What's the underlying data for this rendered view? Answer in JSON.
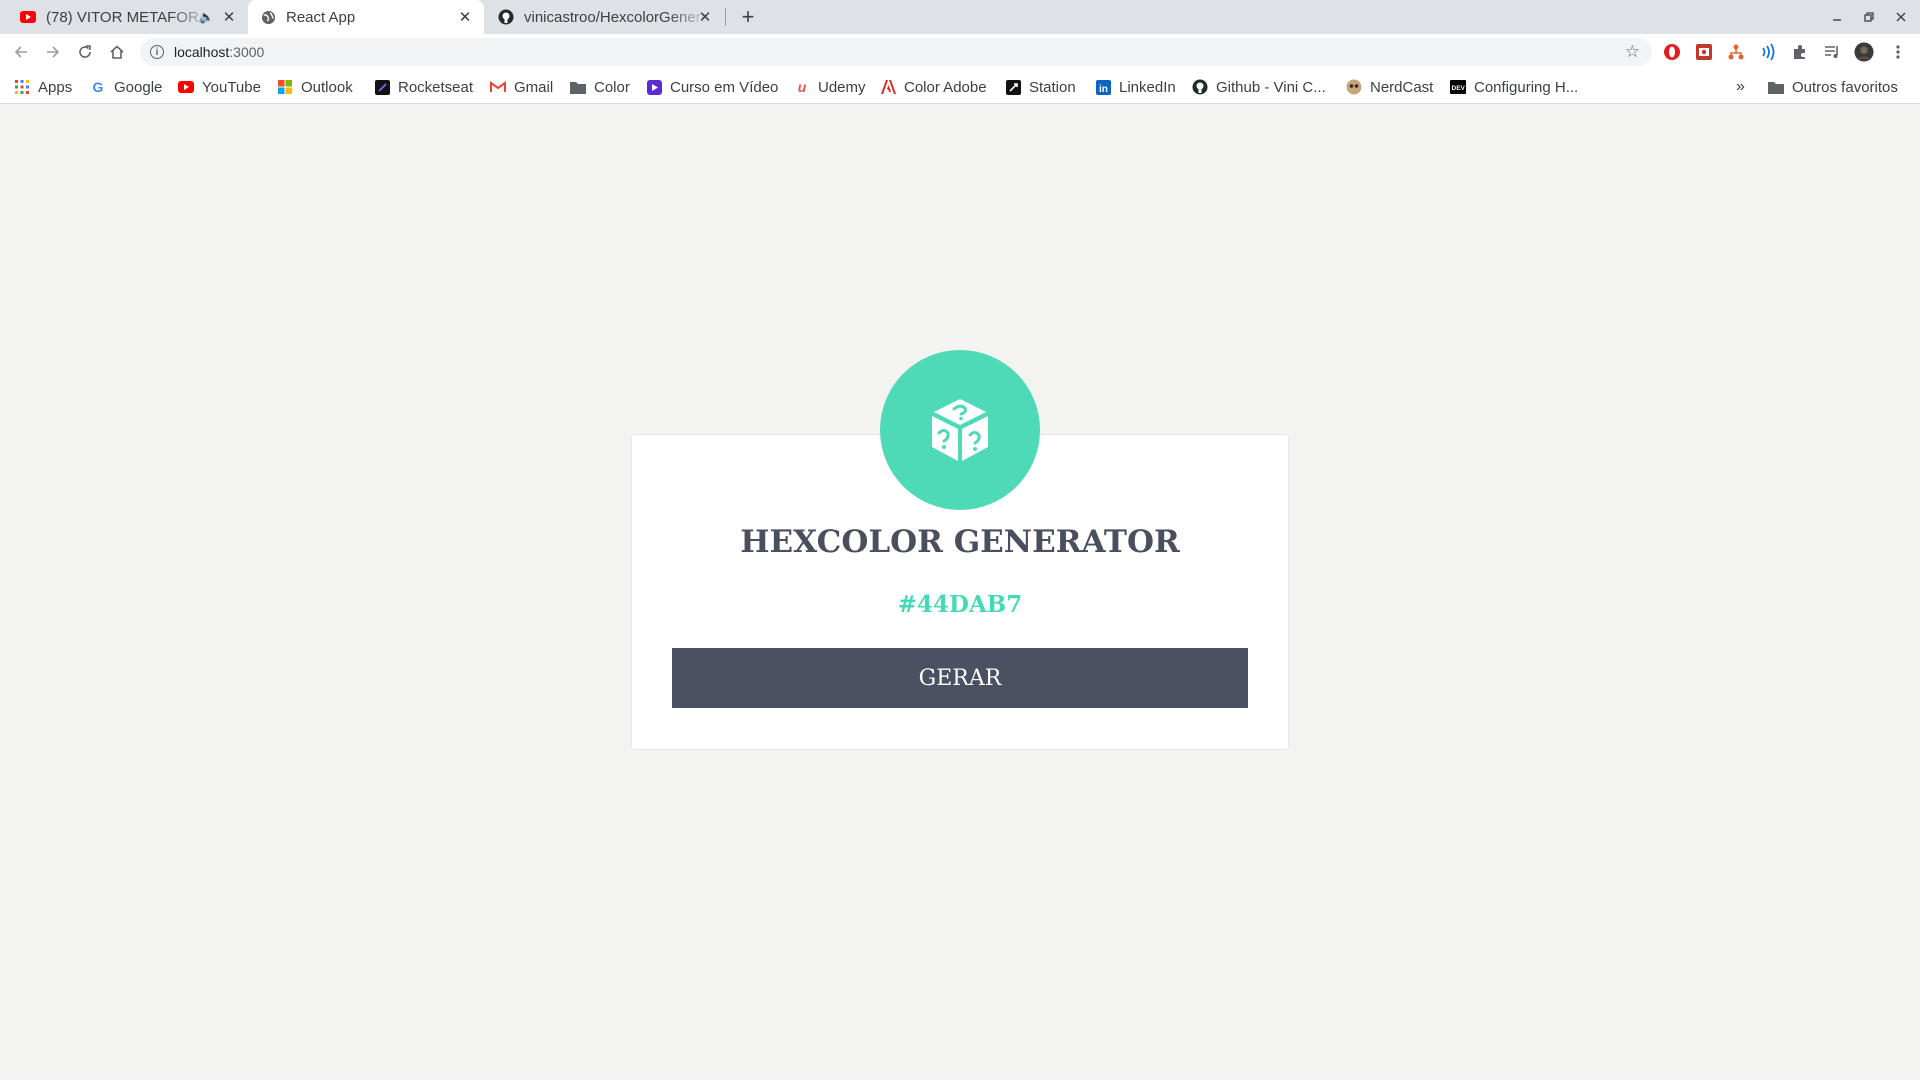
{
  "browser": {
    "tabs": [
      {
        "title": "(78) VITOR METAFORA",
        "favicon": "youtube-icon",
        "audio": true
      },
      {
        "title": "React App",
        "favicon": "globe-icon",
        "active": true
      },
      {
        "title": "vinicastroo/HexcolorGenerator",
        "favicon": "github-icon"
      }
    ],
    "new_tab": "+",
    "address": {
      "host": "localhost",
      "port": ":3000"
    },
    "bookmarks": [
      {
        "label": "Apps",
        "icon": "apps-grid-icon"
      },
      {
        "label": "Google",
        "icon": "google-icon"
      },
      {
        "label": "YouTube",
        "icon": "youtube-icon"
      },
      {
        "label": "Outlook",
        "icon": "microsoft-icon"
      },
      {
        "label": "Rocketseat",
        "icon": "rocketseat-icon"
      },
      {
        "label": "Gmail",
        "icon": "gmail-icon"
      },
      {
        "label": "Color",
        "icon": "folder-icon"
      },
      {
        "label": "Curso em Vídeo",
        "icon": "curso-em-video-icon"
      },
      {
        "label": "Udemy",
        "icon": "udemy-icon"
      },
      {
        "label": "Color Adobe",
        "icon": "adobe-icon"
      },
      {
        "label": "Station",
        "icon": "station-icon"
      },
      {
        "label": "LinkedIn",
        "icon": "linkedin-icon"
      },
      {
        "label": "Github - Vini C...",
        "icon": "github-icon"
      },
      {
        "label": "NerdCast",
        "icon": "nerdcast-icon"
      },
      {
        "label": "Configuring H...",
        "icon": "dev-icon"
      }
    ],
    "more_bookmarks": "»",
    "other_bookmarks": "Outros favoritos"
  },
  "app": {
    "title": "HEXCOLOR GENERATOR",
    "hex": "#44DAB7",
    "button": "GERAR",
    "logo_icon": "dice-question-icon"
  },
  "colors": {
    "accent": "#44DAB7",
    "logo_bg": "#4FDAB7",
    "button_bg": "#4B5162",
    "title_text": "#4A4F5E",
    "page_bg": "#F3F3F2"
  }
}
